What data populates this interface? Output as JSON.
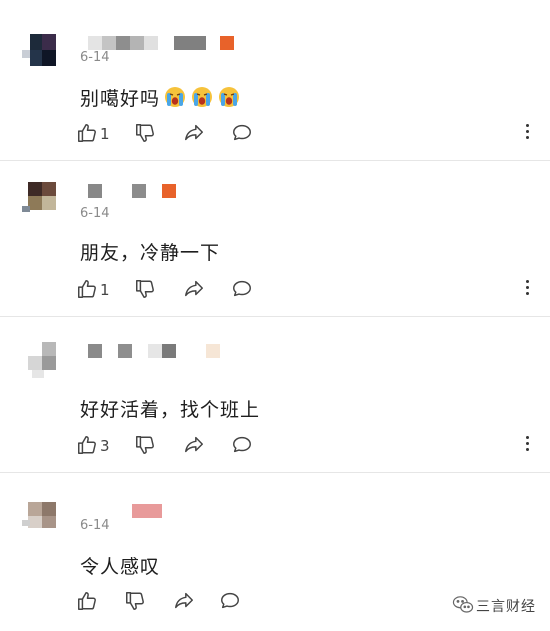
{
  "comments": [
    {
      "date": "6-14",
      "text": "别噶好吗",
      "emojis": [
        "crying-face-icon",
        "crying-face-icon",
        "crying-face-icon"
      ],
      "like_count": "1"
    },
    {
      "date": "6-14",
      "text": "朋友，冷静一下",
      "like_count": "1"
    },
    {
      "date": "",
      "text": "好好活着，找个班上",
      "like_count": "3"
    },
    {
      "date": "6-14",
      "text": "令人感叹",
      "like_count": ""
    }
  ],
  "watermark": {
    "text": "三言财经",
    "icon": "wechat-icon"
  },
  "colors": {
    "divider": "#e6e6e6",
    "text": "#1e1e1e",
    "meta": "#8a8a8a",
    "icon": "#444444",
    "name_badge_orange": "#e8622a"
  }
}
